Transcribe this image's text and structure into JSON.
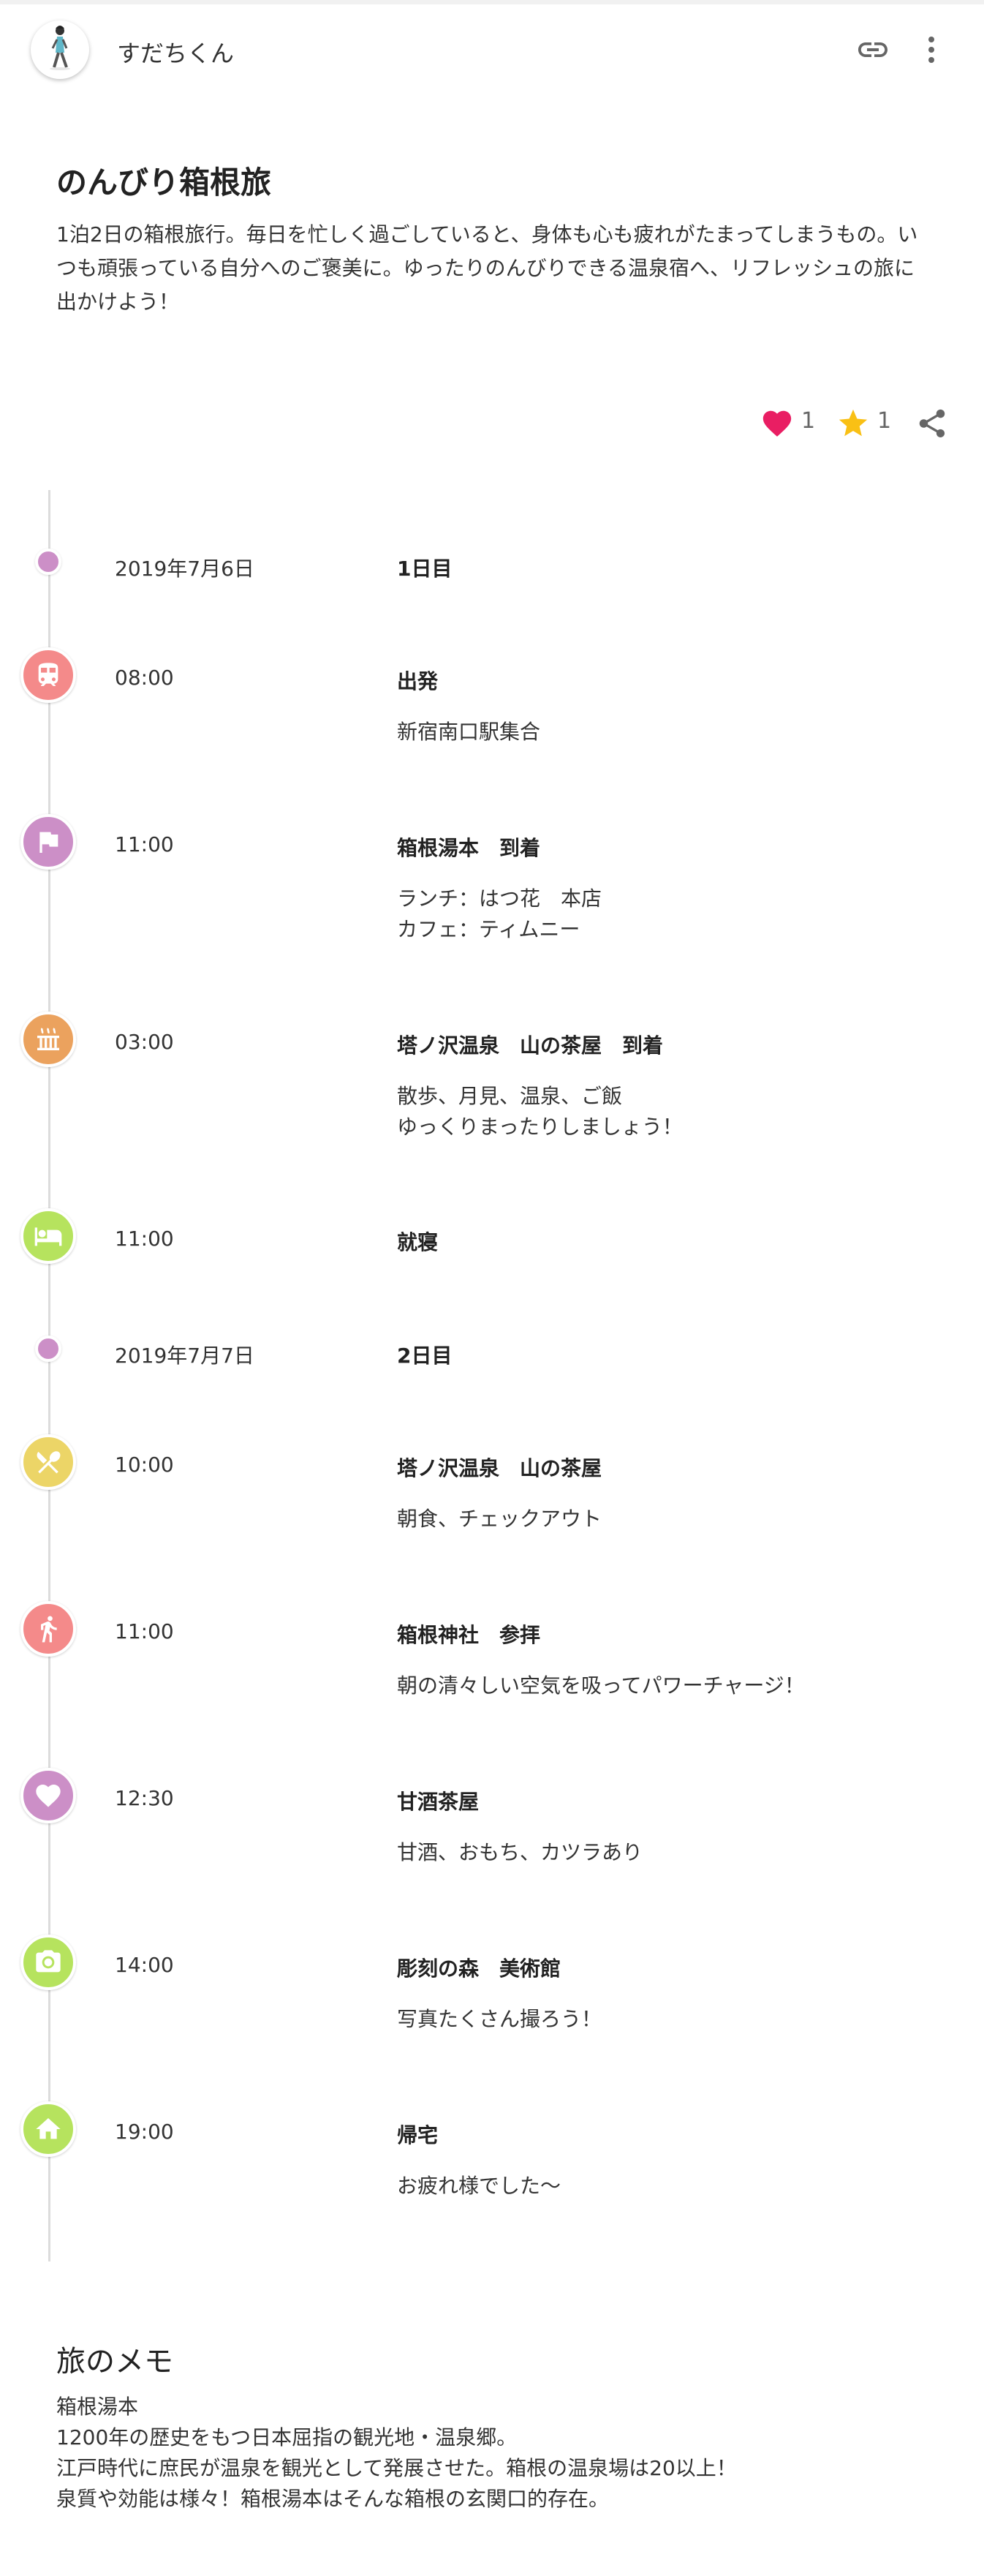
{
  "header": {
    "username": "すだちくん",
    "avatar_icon": "person-walking-avatar",
    "link_icon": "link-icon",
    "menu_icon": "more-vert-icon"
  },
  "plan": {
    "title": "のんびり箱根旅",
    "description": "1泊2日の箱根旅行。毎日を忙しく過ごしていると、身体も心も疲れがたまってしまうもの。いつも頑張っている自分へのご褒美に。ゆったりのんびりできる温泉宿へ、リフレッシュの旅に出かけよう！"
  },
  "actions": {
    "like_count": "1",
    "favorite_count": "1",
    "like_color": "#e91e63",
    "favorite_color": "#f9c015"
  },
  "timeline": {
    "day1": {
      "date": "2019年7月6日",
      "label": "1日目"
    },
    "day2": {
      "date": "2019年7月7日",
      "label": "2日目"
    },
    "events": [
      {
        "time": "08:00",
        "title": "出発",
        "body": "新宿南口駅集合",
        "icon": "train-icon",
        "color": "#f48a8a"
      },
      {
        "time": "11:00",
        "title": "箱根湯本　到着",
        "body": "ランチ：はつ花　本店\nカフェ：ティムニー",
        "icon": "flag-icon",
        "color": "#cc8fc7"
      },
      {
        "time": "03:00",
        "title": "塔ノ沢温泉　山の茶屋　到着",
        "body": "散歩、月見、温泉、ご飯\nゆっくりまったりしましょう！",
        "icon": "hot-spring-icon",
        "color": "#eba25e"
      },
      {
        "time": "11:00",
        "title": "就寝",
        "body": "",
        "icon": "bed-icon",
        "color": "#b6e35e"
      },
      {
        "time": "10:00",
        "title": "塔ノ沢温泉　山の茶屋",
        "body": "朝食、チェックアウト",
        "icon": "restaurant-icon",
        "color": "#ecd567"
      },
      {
        "time": "11:00",
        "title": "箱根神社　参拝",
        "body": "朝の清々しい空気を吸ってパワーチャージ！",
        "icon": "walking-icon",
        "color": "#f48a8a"
      },
      {
        "time": "12:30",
        "title": "甘酒茶屋",
        "body": "甘酒、おもち、カツラあり",
        "icon": "heart-icon",
        "color": "#cc8fc7"
      },
      {
        "time": "14:00",
        "title": "彫刻の森　美術館",
        "body": "写真たくさん撮ろう！",
        "icon": "camera-icon",
        "color": "#b6e35e"
      },
      {
        "time": "19:00",
        "title": "帰宅",
        "body": "お疲れ様でした〜",
        "icon": "home-icon",
        "color": "#b6e35e"
      }
    ]
  },
  "memo": {
    "title": "旅のメモ",
    "lines": [
      "箱根湯本",
      "1200年の歴史をもつ日本屈指の観光地・温泉郷。",
      "江戸時代に庶民が温泉を観光として発展させた。箱根の温泉場は20以上！",
      "泉質や効能は様々！箱根湯本はそんな箱根の玄関口的存在。"
    ]
  }
}
